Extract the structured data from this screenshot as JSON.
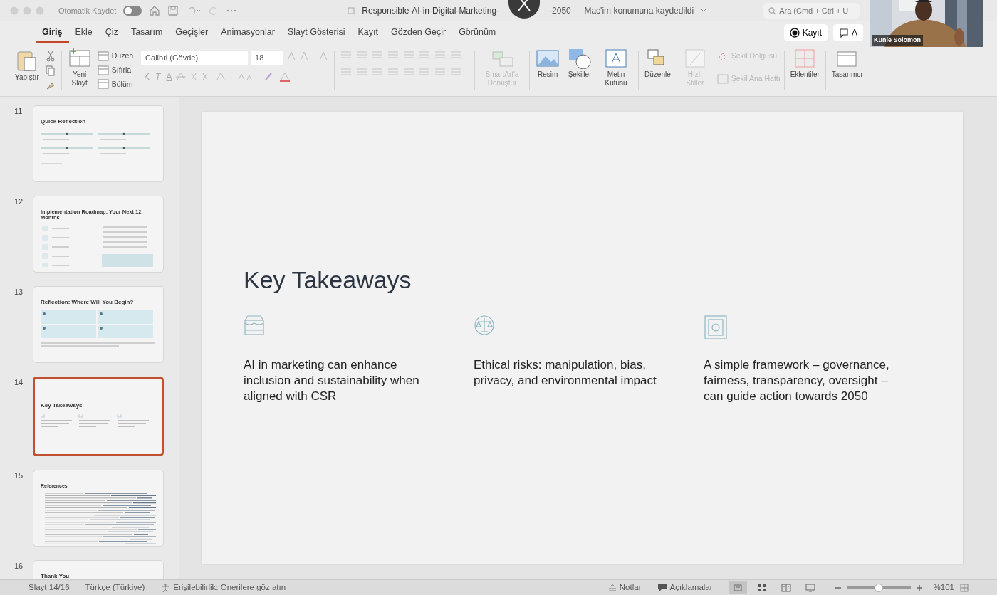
{
  "title_bar": {
    "autosave_label": "Otomatik Kaydet",
    "autosave_on": false,
    "title_start": "Responsible-AI-in-Digital-Marketing-",
    "title_end": "-2050 — Mac'im konumuna kaydedildi",
    "search": {
      "placeholder": "Ara (Cmd + Ctrl + U"
    }
  },
  "ribbon_tabs": [
    {
      "label": "Giriş",
      "selected": true
    },
    {
      "label": "Ekle",
      "selected": false
    },
    {
      "label": "Çiz",
      "selected": false
    },
    {
      "label": "Tasarım",
      "selected": false
    },
    {
      "label": "Geçişler",
      "selected": false
    },
    {
      "label": "Animasyonlar",
      "selected": false
    },
    {
      "label": "Slayt Gösterisi",
      "selected": false
    },
    {
      "label": "Kayıt",
      "selected": false
    },
    {
      "label": "Gözden Geçir",
      "selected": false
    },
    {
      "label": "Görünüm",
      "selected": false
    }
  ],
  "record_button": "Kayıt",
  "comments_button": "A",
  "ribbon": {
    "paste": "Yapıştır",
    "new_slide": "Yeni Slayt",
    "slide_menu": [
      "Düzen",
      "Sıfırla",
      "Bölüm"
    ],
    "font": "Calibri (Gövde)",
    "size": "18",
    "format_letters": [
      "K",
      "T",
      "A"
    ],
    "large_buttons": [
      {
        "label": "SmartArt'a Dönüştür",
        "kind": "smartart",
        "disabled": true
      },
      {
        "label": "Resim",
        "kind": "picture",
        "disabled": false
      },
      {
        "label": "Şekiller",
        "kind": "shapes",
        "disabled": false
      },
      {
        "label": "Metin Kutusu",
        "kind": "textbox",
        "disabled": false
      },
      {
        "label": "Düzenle",
        "kind": "arrange",
        "disabled": false
      },
      {
        "label": "Hızlı Stiller",
        "kind": "styles",
        "disabled": true
      }
    ],
    "shape_menu": [
      {
        "label": "Şekil Dolgusu",
        "kind": "fill",
        "disabled": true
      },
      {
        "label": "Şekil Ana Hattı",
        "kind": "outline",
        "disabled": true
      }
    ],
    "end_buttons": [
      {
        "label": "Eklentiler",
        "kind": "addins"
      },
      {
        "label": "Tasarımcı",
        "kind": "designer"
      }
    ]
  },
  "thumbnails": [
    {
      "number": "11",
      "title": "Quick Reflection",
      "kind": "sliders",
      "selected": false
    },
    {
      "number": "12",
      "title": "Implementation Roadmap: Your Next 12 Months",
      "kind": "roadmap",
      "selected": false
    },
    {
      "number": "13",
      "title": "Reflection: Where Will You Begin?",
      "kind": "grid",
      "selected": false
    },
    {
      "number": "14",
      "title": "Key Takeaways",
      "kind": "columns",
      "selected": true
    },
    {
      "number": "15",
      "title": "References",
      "kind": "references",
      "selected": false
    },
    {
      "number": "16",
      "title": "Thank You",
      "kind": "plain",
      "selected": false
    }
  ],
  "slide": {
    "title": "Key Takeaways",
    "points": [
      {
        "text": "AI in marketing can enhance inclusion and sustainability when aligned with CSR"
      },
      {
        "text": "Ethical risks: manipulation, bias, privacy, and environmental impact"
      },
      {
        "text": "A simple framework – governance, fairness, transparency, oversight – can guide action towards 2050"
      }
    ]
  },
  "video": {
    "name": "Kunle Solomon"
  },
  "status_bar": {
    "slide": "Slayt 14/16",
    "language": "Türkçe (Türkiye)",
    "accessibility": "Erişilebilirlik: Önerilere göz atın",
    "notes": "Notlar",
    "comments": "Açıklamalar",
    "views": [
      {
        "selected": true
      },
      {
        "selected": false
      },
      {
        "selected": false
      },
      {
        "selected": false
      }
    ],
    "level": 0.5,
    "zoom": "%101"
  }
}
